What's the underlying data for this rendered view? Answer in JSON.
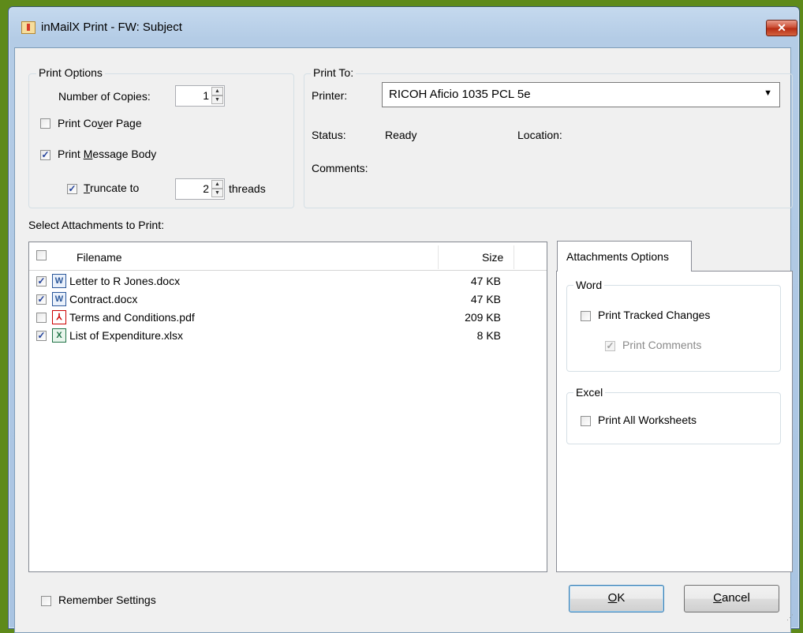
{
  "window": {
    "title": "inMailX Print - FW: Subject",
    "close_glyph": "✕"
  },
  "print_options": {
    "title": "Print Options",
    "copies_label": "Number of Copies:",
    "copies_value": "1",
    "cover_page_label_pre": "Print Co",
    "cover_page_label_ul": "v",
    "cover_page_label_post": "er Page",
    "cover_page_checked": false,
    "message_body_label_pre": "Print ",
    "message_body_label_ul": "M",
    "message_body_label_post": "essage Body",
    "message_body_checked": true,
    "truncate_label_ul": "T",
    "truncate_label_post": "runcate to",
    "truncate_checked": true,
    "threads_value": "2",
    "threads_label": "threads"
  },
  "print_to": {
    "title": "Print To:",
    "printer_label": "Printer:",
    "printer_value": "RICOH Aficio 1035 PCL 5e",
    "status_label": "Status:",
    "status_value": "Ready",
    "location_label": "Location:",
    "location_value": "",
    "comments_label": "Comments:",
    "comments_value": ""
  },
  "attachments": {
    "section_label": "Select Attachments to Print:",
    "columns": {
      "filename": "Filename",
      "size": "Size"
    },
    "rows": [
      {
        "filename": "Letter to R Jones.docx",
        "size": "47 KB",
        "checked": true,
        "icon": "word-doc-icon",
        "glyph": "W"
      },
      {
        "filename": "Contract.docx",
        "size": "47 KB",
        "checked": true,
        "icon": "word-doc-icon",
        "glyph": "W"
      },
      {
        "filename": "Terms and Conditions.pdf",
        "size": "209 KB",
        "checked": false,
        "icon": "pdf-icon",
        "glyph": "⅄"
      },
      {
        "filename": "List of Expenditure.xlsx",
        "size": "8 KB",
        "checked": true,
        "icon": "excel-doc-icon",
        "glyph": "X"
      }
    ]
  },
  "attachments_options": {
    "tab_label": "Attachments Options",
    "word_group": "Word",
    "tracked_changes_label": "Print Tracked Changes",
    "tracked_changes_checked": false,
    "comments_label": "Print Comments",
    "comments_checked": true,
    "excel_group": "Excel",
    "all_worksheets_label": "Print All Worksheets",
    "all_worksheets_checked": false
  },
  "footer": {
    "remember_label": "Remember Settings",
    "remember_checked": false,
    "ok_ul": "O",
    "ok_post": "K",
    "cancel_ul": "C",
    "cancel_post": "ancel"
  },
  "colors": {
    "desktop": "#5e8a1a",
    "window_frame": "#b4cce6",
    "close_button": "#c7462c",
    "check_mark": "#21409a"
  }
}
